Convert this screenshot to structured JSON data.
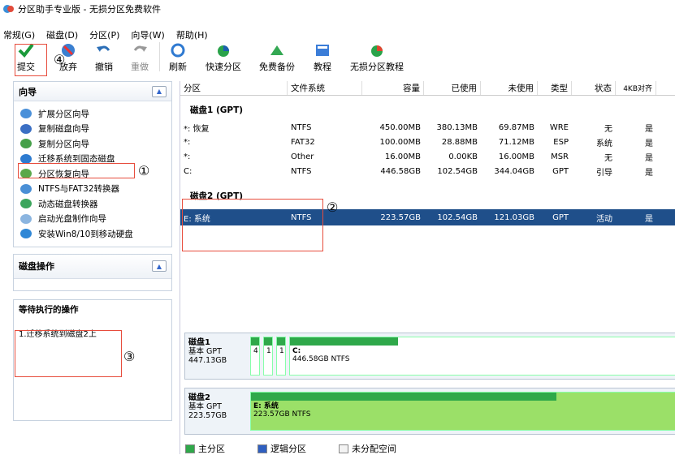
{
  "window": {
    "title": "分区助手专业版 - 无损分区免费软件"
  },
  "menu": [
    "常规(G)",
    "磁盘(D)",
    "分区(P)",
    "向导(W)",
    "帮助(H)"
  ],
  "toolbar": {
    "commit": "提交",
    "discard": "放弃",
    "undo": "撤销",
    "redo": "重做",
    "refresh": "刷新",
    "quick_partition": "快速分区",
    "free_backup": "免费备份",
    "tutorial": "教程",
    "lossless_tutorial": "无损分区教程"
  },
  "annotations": {
    "n1": "①",
    "n2": "②",
    "n3": "③",
    "n4": "④"
  },
  "wizard": {
    "title": "向导",
    "items": [
      "扩展分区向导",
      "复制磁盘向导",
      "复制分区向导",
      "迁移系统到固态磁盘",
      "分区恢复向导",
      "NTFS与FAT32转换器",
      "动态磁盘转换器",
      "启动光盘制作向导",
      "安装Win8/10到移动硬盘"
    ]
  },
  "disk_ops": {
    "title": "磁盘操作"
  },
  "pending": {
    "title": "等待执行的操作",
    "item1": "1.迁移系统到磁盘2上"
  },
  "columns": [
    "分区",
    "文件系统",
    "容量",
    "已使用",
    "未使用",
    "类型",
    "状态",
    "4KB对齐"
  ],
  "disk1": {
    "title": "磁盘1 (GPT)",
    "rows": [
      [
        "*: 恢复",
        "NTFS",
        "450.00MB",
        "380.13MB",
        "69.87MB",
        "WRE",
        "无",
        "是"
      ],
      [
        "*:",
        "FAT32",
        "100.00MB",
        "28.88MB",
        "71.12MB",
        "ESP",
        "系统",
        "是"
      ],
      [
        "*:",
        "Other",
        "16.00MB",
        "0.00KB",
        "16.00MB",
        "MSR",
        "无",
        "是"
      ],
      [
        "C:",
        "NTFS",
        "446.58GB",
        "102.54GB",
        "344.04GB",
        "GPT",
        "引导",
        "是"
      ]
    ]
  },
  "disk2": {
    "title": "磁盘2 (GPT)",
    "rows": [
      [
        "E: 系统",
        "NTFS",
        "223.57GB",
        "102.54GB",
        "121.03GB",
        "GPT",
        "活动",
        "是"
      ]
    ]
  },
  "map1": {
    "name": "磁盘1",
    "type": "基本 GPT",
    "size": "447.13GB",
    "p1": "4",
    "p2": "1",
    "p3": "1",
    "pc_label": "C:",
    "pc_info": "446.58GB NTFS"
  },
  "map2": {
    "name": "磁盘2",
    "type": "基本 GPT",
    "size": "223.57GB",
    "pe_label": "E: 系统",
    "pe_info": "223.57GB NTFS"
  },
  "legend": {
    "primary": "主分区",
    "logical": "逻辑分区",
    "unalloc": "未分配空间"
  },
  "colors": {
    "selection": "#1f4f8a",
    "used_bar": "#2fa84a",
    "annotation_red": "#e74c3c"
  }
}
